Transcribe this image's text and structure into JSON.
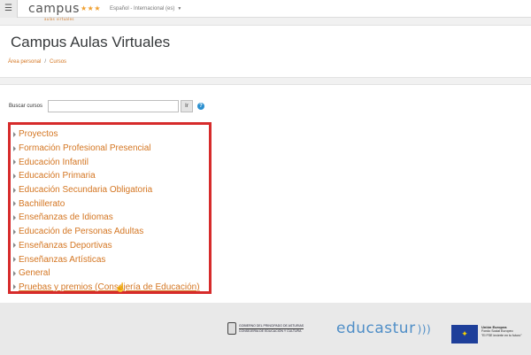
{
  "topbar": {
    "logo_text": "campus",
    "logo_stars": "★★★",
    "logo_tagline": "aulas virtuales",
    "language": "Español - Internacional (es)"
  },
  "header": {
    "title": "Campus Aulas Virtuales",
    "breadcrumb": [
      "Área personal",
      "Cursos"
    ],
    "breadcrumb_separator": "/"
  },
  "search": {
    "label": "Buscar cursos",
    "value": "",
    "button_label": "Ir",
    "help_icon": "question-circle-icon"
  },
  "categories": [
    "Proyectos",
    "Formación Profesional Presencial",
    "Educación Infantil",
    "Educación Primaria",
    "Educación Secundaria Obligatoria",
    "Bachillerato",
    "Enseñanzas de Idiomas",
    "Educación de Personas Adultas",
    "Enseñanzas Deportivas",
    "Enseñanzas Artísticas",
    "General",
    "Pruebas y premios (Consejería de Educación)"
  ],
  "footer": {
    "gov_line1": "GOBIERNO DEL PRINCIPADO DE ASTURIAS",
    "gov_line2": "CONSEJERÍA DE EDUCACIÓN Y CULTURA",
    "educastur": "educastur",
    "eu_title": "Unión Europea",
    "eu_line1": "Fondo Social Europeo",
    "eu_line2": "\"El FSE invierte en tu futuro\""
  },
  "colors": {
    "accent_orange": "#d47622",
    "highlight_red": "#d62b2b",
    "edu_blue": "#4f8ec7"
  }
}
